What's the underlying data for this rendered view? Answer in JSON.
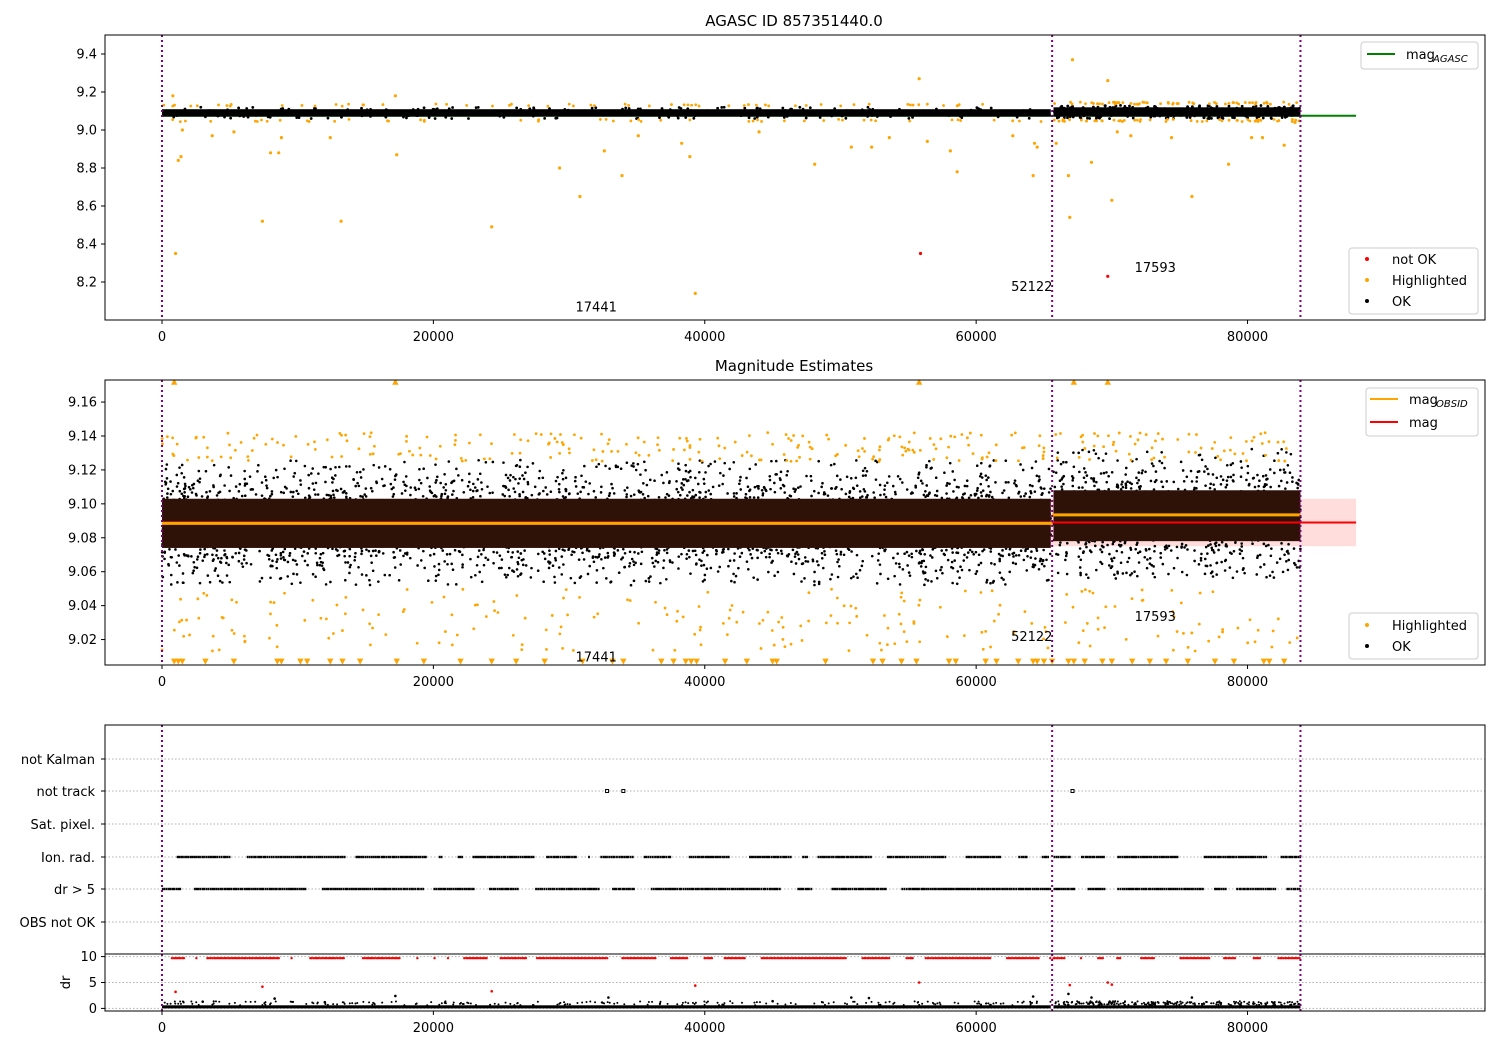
{
  "chart_data": [
    {
      "type": "scatter",
      "title": "AGASC ID 857351440.0",
      "xlim": [
        -4200,
        97500
      ],
      "ylim": [
        8.0,
        9.5
      ],
      "xticks": [
        0,
        20000,
        40000,
        60000,
        80000
      ],
      "xtick_labels": [
        "0",
        "20000",
        "40000",
        "60000",
        "80000"
      ],
      "yticks": [
        8.2,
        8.4,
        8.6,
        8.8,
        9.0,
        9.2,
        9.4
      ],
      "ytick_labels": [
        "8.2",
        "8.4",
        "8.6",
        "8.8",
        "9.0",
        "9.2",
        "9.4"
      ],
      "colors": {
        "ok": "#000000",
        "highlighted": "#ffa500",
        "not_ok": "#ff0000",
        "agasc_line": "#008000",
        "obsid_boundary": "#800080"
      },
      "obsid_boundaries": [
        0,
        65600,
        83900
      ],
      "obsid_labels": [
        {
          "text": "17441",
          "x": 32000,
          "y": 8.07
        },
        {
          "text": "52122",
          "x": 64100,
          "y": 8.18
        },
        {
          "text": "17593",
          "x": 73200,
          "y": 8.28
        }
      ],
      "mag_agasc": 9.075,
      "ok_band": {
        "segments": [
          {
            "x": [
              0,
              65500
            ],
            "y": [
              9.06,
              9.12
            ]
          },
          {
            "x": [
              65700,
              83900
            ],
            "y": [
              9.06,
              9.13
            ]
          }
        ]
      },
      "highlighted_points": [
        {
          "x": 1000,
          "y": 8.35
        },
        {
          "x": 1200,
          "y": 8.84
        },
        {
          "x": 1400,
          "y": 8.86
        },
        {
          "x": 1500,
          "y": 9.0
        },
        {
          "x": 800,
          "y": 9.18
        },
        {
          "x": 3700,
          "y": 8.97
        },
        {
          "x": 5300,
          "y": 8.99
        },
        {
          "x": 7400,
          "y": 8.52
        },
        {
          "x": 8000,
          "y": 8.88
        },
        {
          "x": 8600,
          "y": 8.88
        },
        {
          "x": 8800,
          "y": 8.96
        },
        {
          "x": 13200,
          "y": 8.52
        },
        {
          "x": 12400,
          "y": 8.96
        },
        {
          "x": 17300,
          "y": 8.87
        },
        {
          "x": 17200,
          "y": 9.18
        },
        {
          "x": 24300,
          "y": 8.49
        },
        {
          "x": 29300,
          "y": 8.8
        },
        {
          "x": 30800,
          "y": 8.65
        },
        {
          "x": 32600,
          "y": 8.89
        },
        {
          "x": 33900,
          "y": 8.76
        },
        {
          "x": 35100,
          "y": 8.97
        },
        {
          "x": 38300,
          "y": 8.93
        },
        {
          "x": 38900,
          "y": 8.86
        },
        {
          "x": 39300,
          "y": 8.14
        },
        {
          "x": 44000,
          "y": 8.99
        },
        {
          "x": 48100,
          "y": 8.82
        },
        {
          "x": 50800,
          "y": 8.91
        },
        {
          "x": 52300,
          "y": 8.91
        },
        {
          "x": 53600,
          "y": 8.96
        },
        {
          "x": 55800,
          "y": 9.27
        },
        {
          "x": 56400,
          "y": 8.94
        },
        {
          "x": 58100,
          "y": 8.89
        },
        {
          "x": 58600,
          "y": 8.78
        },
        {
          "x": 62700,
          "y": 8.97
        },
        {
          "x": 64200,
          "y": 8.76
        },
        {
          "x": 64300,
          "y": 8.93
        },
        {
          "x": 64500,
          "y": 8.91
        },
        {
          "x": 65900,
          "y": 8.93
        },
        {
          "x": 66800,
          "y": 8.76
        },
        {
          "x": 66900,
          "y": 8.54
        },
        {
          "x": 67100,
          "y": 9.37
        },
        {
          "x": 68500,
          "y": 8.83
        },
        {
          "x": 69700,
          "y": 9.26
        },
        {
          "x": 70000,
          "y": 8.63
        },
        {
          "x": 70400,
          "y": 8.99
        },
        {
          "x": 71400,
          "y": 8.97
        },
        {
          "x": 74400,
          "y": 8.96
        },
        {
          "x": 75900,
          "y": 8.65
        },
        {
          "x": 78600,
          "y": 8.82
        },
        {
          "x": 80300,
          "y": 8.96
        },
        {
          "x": 81100,
          "y": 8.96
        },
        {
          "x": 82700,
          "y": 8.92
        },
        {
          "x": 83500,
          "y": 9.04
        }
      ],
      "not_ok_points": [
        {
          "x": 55900,
          "y": 8.35
        },
        {
          "x": 69700,
          "y": 8.23
        }
      ],
      "legend_top": {
        "position": "top-right",
        "entries": [
          {
            "label": "mag",
            "sub": "AGASC",
            "style": "line",
            "color": "#008000"
          }
        ]
      },
      "legend_bottom": {
        "position": "bottom-right",
        "entries": [
          {
            "label": "not OK",
            "style": "dot",
            "color": "#ff0000"
          },
          {
            "label": "Highlighted",
            "style": "dot",
            "color": "#ffa500"
          },
          {
            "label": "OK",
            "style": "dot",
            "color": "#000000"
          }
        ]
      }
    },
    {
      "type": "scatter",
      "title": "Magnitude Estimates",
      "xlim": [
        -4200,
        97500
      ],
      "ylim": [
        9.005,
        9.173
      ],
      "xticks": [
        0,
        20000,
        40000,
        60000,
        80000
      ],
      "xtick_labels": [
        "0",
        "20000",
        "40000",
        "60000",
        "80000"
      ],
      "yticks": [
        9.02,
        9.04,
        9.06,
        9.08,
        9.1,
        9.12,
        9.14,
        9.16
      ],
      "ytick_labels": [
        "9.02",
        "9.04",
        "9.06",
        "9.08",
        "9.10",
        "9.12",
        "9.14",
        "9.16"
      ],
      "colors": {
        "ok": "#000000",
        "highlighted": "#ffa500",
        "mag": "#ff0000",
        "mag_obsid": "#ffa500",
        "band": "#ffdddd",
        "dense_core": "#2e1208"
      },
      "obsid_boundaries": [
        0,
        65600,
        83900
      ],
      "obsid_labels": [
        {
          "text": "17441",
          "x": 32000,
          "y": 9.01
        },
        {
          "text": "52122",
          "x": 64100,
          "y": 9.022
        },
        {
          "text": "17593",
          "x": 73200,
          "y": 9.034
        }
      ],
      "mag": 9.089,
      "mag_band": [
        9.075,
        9.103
      ],
      "mag_band_x": [
        0,
        88000
      ],
      "mag_obsid": [
        {
          "x": [
            0,
            65600
          ],
          "y": 9.0885
        },
        {
          "x": [
            65600,
            83900
          ],
          "y": 9.0935
        }
      ],
      "ok_segments": [
        {
          "x": [
            0,
            65500
          ],
          "y_inner": [
            9.074,
            9.103
          ],
          "y_outer": [
            9.052,
            9.126
          ]
        },
        {
          "x": [
            65700,
            83900
          ],
          "y_inner": [
            9.078,
            9.108
          ],
          "y_outer": [
            9.056,
            9.133
          ]
        }
      ],
      "highlighted_upper_range": [
        9.125,
        9.142
      ],
      "highlighted_lower_range": [
        9.013,
        9.05
      ],
      "clipped_marker_y": 9.007,
      "clipped_top_y": 9.172,
      "legend_top": {
        "position": "top-right",
        "entries": [
          {
            "label": "mag",
            "sub": "OBSID",
            "style": "line",
            "color": "#ffa500"
          },
          {
            "label": "mag",
            "style": "line",
            "color": "#ff0000"
          }
        ]
      },
      "legend_bottom": {
        "position": "bottom-right",
        "entries": [
          {
            "label": "Highlighted",
            "style": "dot",
            "color": "#ffa500"
          },
          {
            "label": "OK",
            "style": "dot",
            "color": "#000000"
          }
        ]
      }
    },
    {
      "type": "scatter",
      "title": "",
      "xlim": [
        -4200,
        97500
      ],
      "categories": [
        "not Kalman",
        "not track",
        "Sat. pixel.",
        "Ion. rad.",
        "dr > 5",
        "OBS not OK"
      ],
      "flag_rows": [
        {
          "label": "not Kalman",
          "segments": []
        },
        {
          "label": "not track",
          "segments": [],
          "points": [
            32800,
            34000,
            67100
          ]
        },
        {
          "label": "Sat. pixel.",
          "segments": []
        },
        {
          "label": "Ion. rad.",
          "segments": [
            [
              0,
              65500
            ],
            [
              65700,
              69400
            ],
            [
              70400,
              83900
            ]
          ]
        },
        {
          "label": "dr > 5",
          "segments": [
            [
              0,
              65500
            ],
            [
              65700,
              69400
            ],
            [
              70400,
              83900
            ]
          ]
        },
        {
          "label": "OBS not OK",
          "segments": []
        }
      ],
      "obsid_boundaries": [
        0,
        65600,
        83900
      ],
      "colors": {
        "ok": "#000000",
        "grid": "#b0b0b0",
        "obsid_boundary": "#800080"
      }
    },
    {
      "type": "scatter",
      "title": "",
      "ylabel": "dr",
      "xlim": [
        -4200,
        97500
      ],
      "ylim": [
        -0.5,
        10.5
      ],
      "xticks": [
        0,
        20000,
        40000,
        60000,
        80000
      ],
      "xtick_labels": [
        "0",
        "20000",
        "40000",
        "60000",
        "80000"
      ],
      "yticks": [
        0,
        5,
        10
      ],
      "ytick_labels": [
        "0",
        "5",
        "10"
      ],
      "colors": {
        "ok": "#000000",
        "above": "#ff0000"
      },
      "clipped_row": {
        "y": 9.7,
        "segments": [
          [
            0,
            65500
          ],
          [
            65700,
            69400
          ],
          [
            70400,
            83900
          ]
        ]
      },
      "ok_band": {
        "y": [
          0,
          0.6
        ],
        "segments": [
          [
            0,
            65500
          ],
          [
            65700,
            83900
          ]
        ]
      },
      "scattered_points": [
        {
          "x": 1000,
          "y": 3.2,
          "c": "red"
        },
        {
          "x": 7400,
          "y": 4.2,
          "c": "red"
        },
        {
          "x": 24300,
          "y": 3.3,
          "c": "red"
        },
        {
          "x": 39300,
          "y": 4.4,
          "c": "red"
        },
        {
          "x": 55800,
          "y": 5.0,
          "c": "red"
        },
        {
          "x": 66900,
          "y": 4.5,
          "c": "red"
        },
        {
          "x": 69700,
          "y": 5.0,
          "c": "red"
        },
        {
          "x": 70000,
          "y": 4.6,
          "c": "red"
        },
        {
          "x": 17200,
          "y": 2.4,
          "c": "black"
        },
        {
          "x": 8300,
          "y": 1.9,
          "c": "black"
        },
        {
          "x": 32900,
          "y": 2.1,
          "c": "black"
        },
        {
          "x": 50800,
          "y": 2.1,
          "c": "black"
        },
        {
          "x": 52100,
          "y": 2.0,
          "c": "black"
        },
        {
          "x": 64200,
          "y": 2.3,
          "c": "black"
        },
        {
          "x": 66800,
          "y": 2.8,
          "c": "black"
        },
        {
          "x": 68500,
          "y": 2.1,
          "c": "black"
        },
        {
          "x": 75900,
          "y": 2.1,
          "c": "black"
        },
        {
          "x": 3000,
          "y": 1.3,
          "c": "black"
        },
        {
          "x": 12000,
          "y": 1.2,
          "c": "black"
        },
        {
          "x": 45000,
          "y": 1.4,
          "c": "black"
        }
      ]
    }
  ]
}
